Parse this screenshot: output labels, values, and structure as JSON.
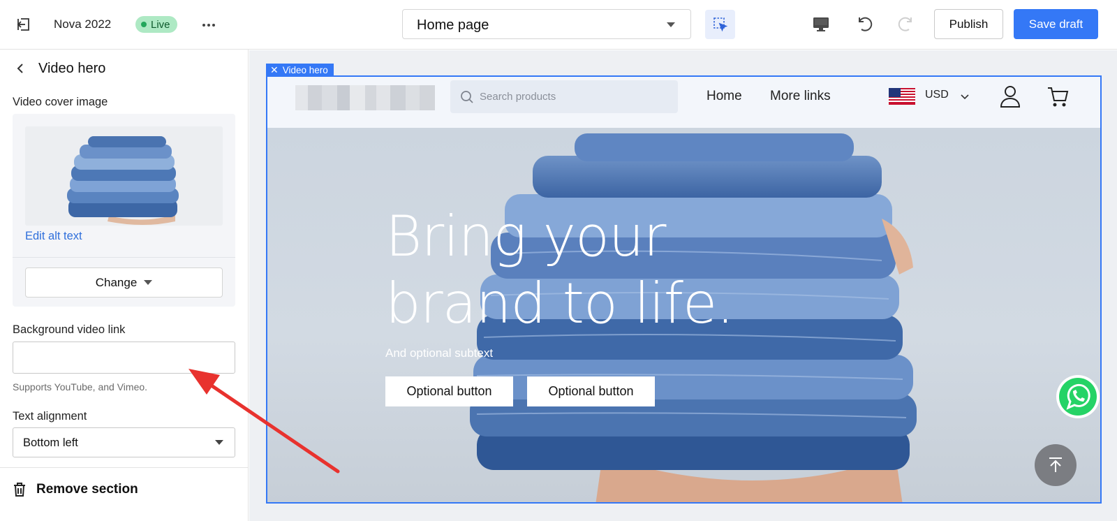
{
  "topbar": {
    "store_name": "Nova 2022",
    "status_badge": "Live",
    "page_selector": "Home page",
    "publish_label": "Publish",
    "save_label": "Save draft"
  },
  "sidebar": {
    "title": "Video hero",
    "cover_image_label": "Video cover image",
    "edit_alt_text": "Edit alt text",
    "change_label": "Change",
    "video_link_label": "Background video link",
    "video_link_value": "",
    "video_link_help": "Supports YouTube, and Vimeo.",
    "alignment_label": "Text alignment",
    "alignment_value": "Bottom left",
    "remove_label": "Remove section"
  },
  "preview": {
    "section_tag": "Video hero",
    "search_placeholder": "Search products",
    "nav": [
      "Home",
      "More links"
    ],
    "currency": "USD",
    "hero_title_line1": "Bring your",
    "hero_title_line2": "brand to life.",
    "hero_subtext": "And optional subtext",
    "button_1": "Optional button",
    "button_2": "Optional button"
  },
  "colors": {
    "accent": "#3478f6",
    "live_badge_bg": "#aee9c4",
    "denim": "#4a74b0"
  },
  "icons": [
    "exit-icon",
    "more-icon",
    "select-element-icon",
    "desktop-icon",
    "undo-icon",
    "redo-icon",
    "back-chevron-icon",
    "trash-icon",
    "search-icon",
    "us-flag-icon",
    "chevron-down-icon",
    "account-icon",
    "cart-icon",
    "whatsapp-icon",
    "scroll-to-top-icon",
    "close-icon"
  ]
}
